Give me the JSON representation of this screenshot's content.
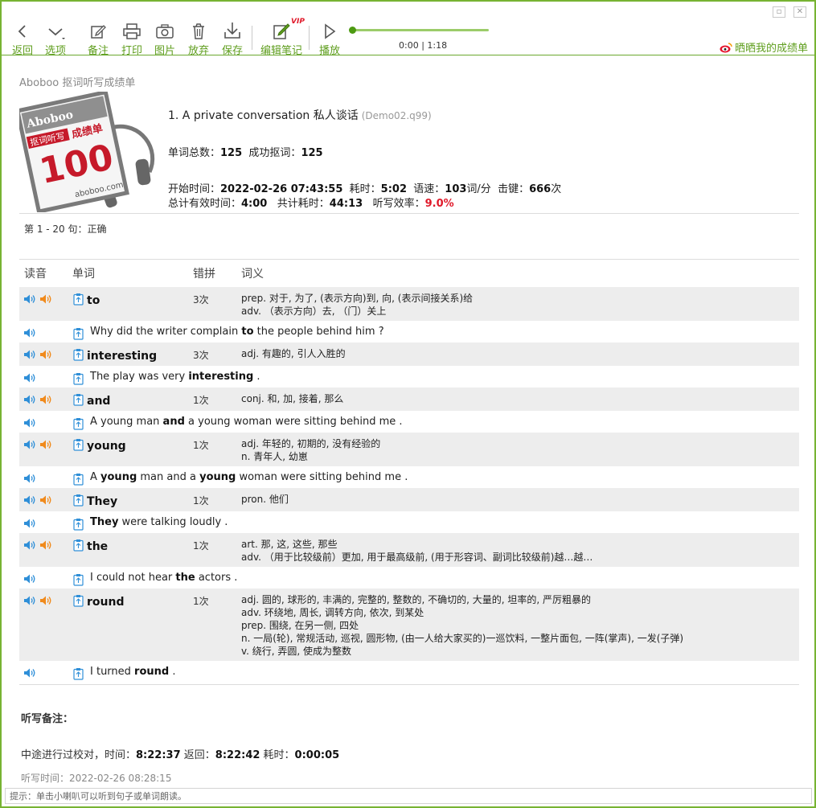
{
  "toolbar": {
    "back": "返回",
    "options": "选项",
    "note": "备注",
    "print": "打印",
    "image": "图片",
    "discard": "放弃",
    "save": "保存",
    "edit_notes": "编辑笔记",
    "vip_badge": "VIP",
    "play": "播放",
    "time": "0:00 | 1:18",
    "share": "晒晒我的成绩单"
  },
  "header": {
    "report_title": "Aboboo 抠词听写成绩单",
    "stamp": {
      "brand": "Aboboo",
      "tag": "抠词听写",
      "tag2": "成绩单",
      "score": "100",
      "site": "aboboo.com"
    },
    "lesson_title": "1. A private conversation 私人谈话",
    "lesson_file": "(Demo02.q99)",
    "stats": {
      "total_words_label": "单词总数：",
      "total_words": "125",
      "success_label": "成功抠词：",
      "success": "125",
      "start_label": "开始时间：",
      "start": "2022-02-26 07:43:55",
      "elapsed_label": "耗时：",
      "elapsed": "5:02",
      "speed_label": "语速：",
      "speed": "103",
      "speed_unit": "词/分",
      "keys_label": "击键：",
      "keys": "666",
      "keys_unit": "次",
      "effective_label": "总计有效时间：",
      "effective": "4:00",
      "total_time_label": "共计耗时：",
      "total_time": "44:13",
      "efficiency_label": "听写效率：",
      "efficiency": "9.0%"
    },
    "range": "第 1 - 20 句：正确"
  },
  "table": {
    "headers": [
      "读音",
      "单词",
      "错拼",
      "词义"
    ],
    "rows": [
      {
        "type": "word",
        "word": "to",
        "count": "3次",
        "defs": [
          "prep. 对于, 为了, (表示方向)到, 向, (表示间接关系)给",
          "adv. （表示方向）去, （门）关上"
        ]
      },
      {
        "type": "sentence",
        "parts": [
          "Why did the writer complain ",
          "to",
          " the people behind him ?"
        ]
      },
      {
        "type": "word",
        "word": "interesting",
        "count": "3次",
        "defs": [
          "adj. 有趣的, 引人入胜的"
        ]
      },
      {
        "type": "sentence",
        "parts": [
          "The play was very ",
          "interesting",
          " ."
        ]
      },
      {
        "type": "word",
        "word": "and",
        "count": "1次",
        "defs": [
          "conj. 和, 加, 接着, 那么"
        ]
      },
      {
        "type": "sentence",
        "parts": [
          "A young man ",
          "and",
          " a young woman were sitting behind me ."
        ]
      },
      {
        "type": "word",
        "word": "young",
        "count": "1次",
        "defs": [
          "adj. 年轻的, 初期的, 没有经验的",
          "n. 青年人, 幼崽"
        ]
      },
      {
        "type": "sentence",
        "parts": [
          "A ",
          "young",
          " man and a ",
          "young",
          " woman were sitting behind me ."
        ]
      },
      {
        "type": "word",
        "word": "They",
        "count": "1次",
        "defs": [
          "pron. 他们"
        ]
      },
      {
        "type": "sentence",
        "parts": [
          "",
          "They",
          " were talking loudly ."
        ]
      },
      {
        "type": "word",
        "word": "the",
        "count": "1次",
        "defs": [
          "art. 那, 这, 这些, 那些",
          "adv. （用于比较级前）更加, 用于最高级前, (用于形容词、副词比较级前)越…越…"
        ]
      },
      {
        "type": "sentence",
        "parts": [
          "I could not hear ",
          "the",
          " actors ."
        ]
      },
      {
        "type": "word",
        "word": "round",
        "count": "1次",
        "defs": [
          "adj. 圆的, 球形的, 丰满的, 完整的, 整数的, 不确切的, 大量的, 坦率的, 严厉粗暴的",
          "adv. 环绕地, 周长, 调转方向, 依次, 到某处",
          "prep. 围绕, 在另一侧, 四处",
          "n. 一局(轮), 常规活动, 巡视, 圆形物, (由一人给大家买的)一巡饮料, 一整片面包, 一阵(掌声), 一发(子弹)",
          "v. 绕行, 弄圆, 使成为整数"
        ]
      },
      {
        "type": "sentence",
        "parts": [
          "I turned ",
          "round",
          " ."
        ]
      }
    ]
  },
  "footer": {
    "notes_title": "听写备注：",
    "proof_prefix": "中途进行过校对，时间：",
    "proof_time": "8:22:37",
    "proof_back_label": " 返回：",
    "proof_back": "8:22:42",
    "proof_elapsed_label": " 耗时：",
    "proof_elapsed": "0:00:05",
    "dictation_time": "听写时间：2022-02-26 08:28:15",
    "hint": "提示：单击小喇叭可以听到句子或单词朗读。"
  },
  "colors": {
    "accent": "#5f9e1e",
    "frame": "#77b332",
    "row_bg": "#ededed",
    "efficiency": "#e0192a",
    "speaker_blue": "#2f8fd8",
    "speaker_orange": "#f08a1c"
  },
  "icons": {
    "word_speakers": [
      "speaker-blue-icon",
      "speaker-orange-icon"
    ],
    "sentence_speaker": "speaker-blue-icon",
    "row_icon": "clipboard-icon"
  }
}
